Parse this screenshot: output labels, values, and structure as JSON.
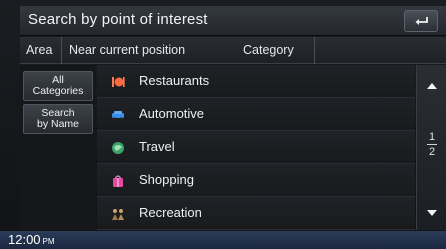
{
  "title": "Search by point of interest",
  "filters": {
    "area_label": "Area",
    "near_label": "Near current position",
    "category_label": "Category"
  },
  "left_buttons": {
    "all_categories": [
      "All",
      "Categories"
    ],
    "search_by_name": [
      "Search",
      "by Name"
    ]
  },
  "list": [
    {
      "label": "Restaurants",
      "icon": "restaurant-icon"
    },
    {
      "label": "Automotive",
      "icon": "car-icon"
    },
    {
      "label": "Travel",
      "icon": "travel-icon"
    },
    {
      "label": "Shopping",
      "icon": "shopping-icon"
    },
    {
      "label": "Recreation",
      "icon": "recreation-icon"
    }
  ],
  "pagination": {
    "current": "1",
    "total": "2"
  },
  "status": {
    "time": "12:00",
    "ampm": "PM"
  },
  "colors": {
    "accent_blue": "#1b2740",
    "title_bar": "#2c3036"
  }
}
